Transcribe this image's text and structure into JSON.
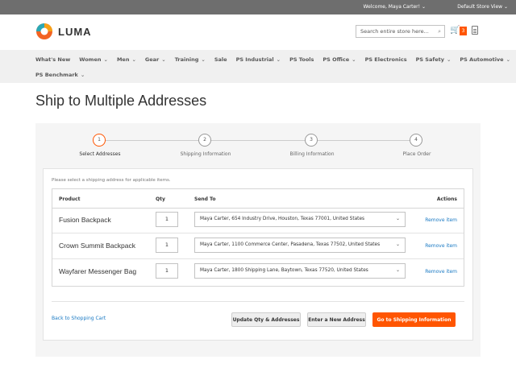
{
  "topbar": {
    "welcome": "Welcome, Maya Carter!",
    "store_view": "Default Store View"
  },
  "header": {
    "logo_text": "LUMA",
    "search_placeholder": "Search entire store here...",
    "cart_count": "3"
  },
  "nav": {
    "row1": [
      "What's New",
      "Women",
      "Men",
      "Gear",
      "Training",
      "Sale",
      "PS Industrial",
      "PS Tools",
      "PS Office",
      "PS Electronics",
      "PS Safety",
      "PS Automotive"
    ],
    "row2": [
      "PS Benchmark"
    ]
  },
  "page": {
    "title": "Ship to Multiple Addresses"
  },
  "steps": [
    {
      "number": "1",
      "label": "Select Addresses"
    },
    {
      "number": "2",
      "label": "Shipping Information"
    },
    {
      "number": "3",
      "label": "Billing Information"
    },
    {
      "number": "4",
      "label": "Place Order"
    }
  ],
  "form": {
    "hint": "Please select a shipping address for applicable items.",
    "columns": {
      "product": "Product",
      "qty": "Qty",
      "send_to": "Send To",
      "actions": "Actions"
    },
    "items": [
      {
        "product": "Fusion Backpack",
        "qty": "1",
        "address": "Maya Carter, 654 Industry Drive, Houston, Texas 77001, United States",
        "action": "Remove item"
      },
      {
        "product": "Crown Summit Backpack",
        "qty": "1",
        "address": "Maya Carter, 1100 Commerce Center, Pasadena, Texas 77502, United States",
        "action": "Remove item"
      },
      {
        "product": "Wayfarer Messenger Bag",
        "qty": "1",
        "address": "Maya Carter, 1800 Shipping Lane, Baytown, Texas 77520, United States",
        "action": "Remove item"
      }
    ]
  },
  "actions": {
    "back": "Back to Shopping Cart",
    "update": "Update Qty & Addresses",
    "new_address": "Enter a New Address",
    "continue": "Go to Shipping Information"
  },
  "colors": {
    "accent": "#ff5501",
    "link": "#1979c3"
  }
}
